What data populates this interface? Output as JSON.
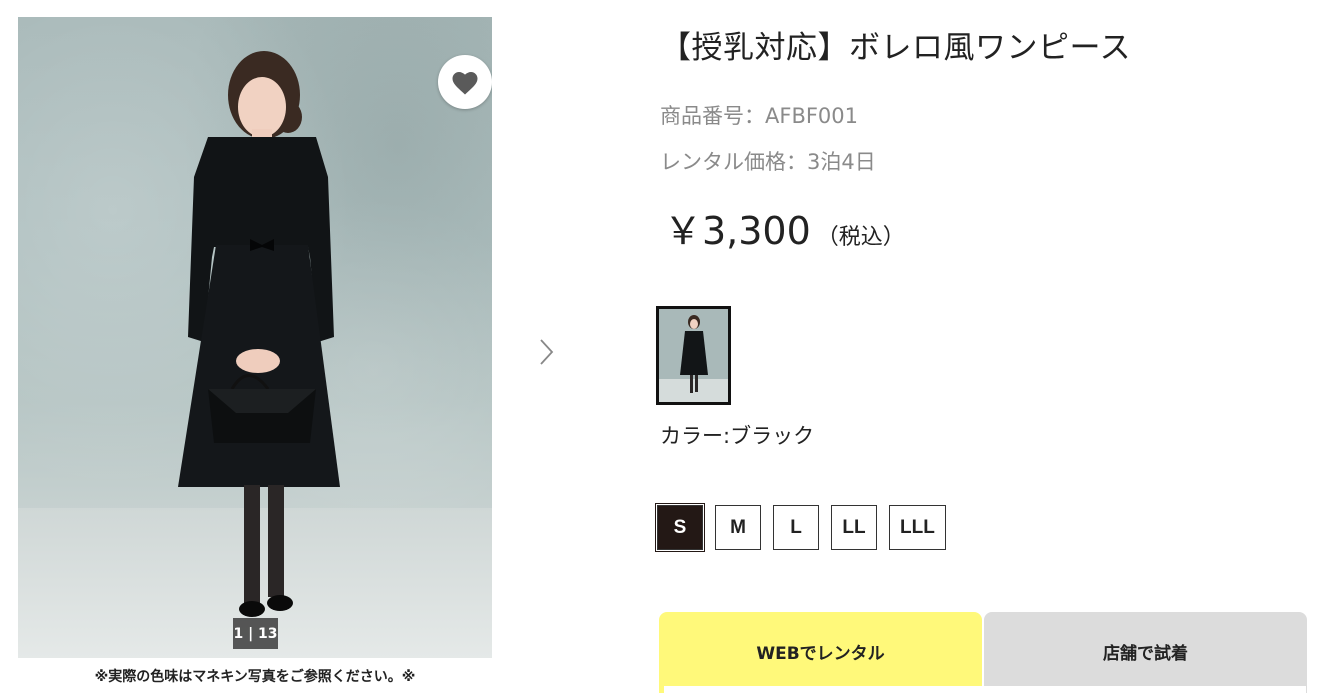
{
  "gallery": {
    "counter_current": "1",
    "counter_total": "13",
    "counter_text": "1 | 13",
    "caption": "※実際の色味はマネキン写真をご参照ください。※"
  },
  "product": {
    "title": "【授乳対応】ボレロ風ワンピース",
    "code_text": "商品番号：AFBF001",
    "rental_text": "レンタル価格：3泊4日",
    "price": "￥3,300",
    "tax_note": "（税込）"
  },
  "color": {
    "label": "カラー:ブラック"
  },
  "sizes": {
    "selected": "S",
    "options": [
      "S",
      "M",
      "L",
      "LL",
      "LLL"
    ]
  },
  "tabs": {
    "web": "WEBでレンタル",
    "store": "店舗で試着"
  },
  "colors": {
    "tab_active": "#fff97a",
    "tab_inactive": "#dcdcdc",
    "size_selected": "#231815"
  }
}
